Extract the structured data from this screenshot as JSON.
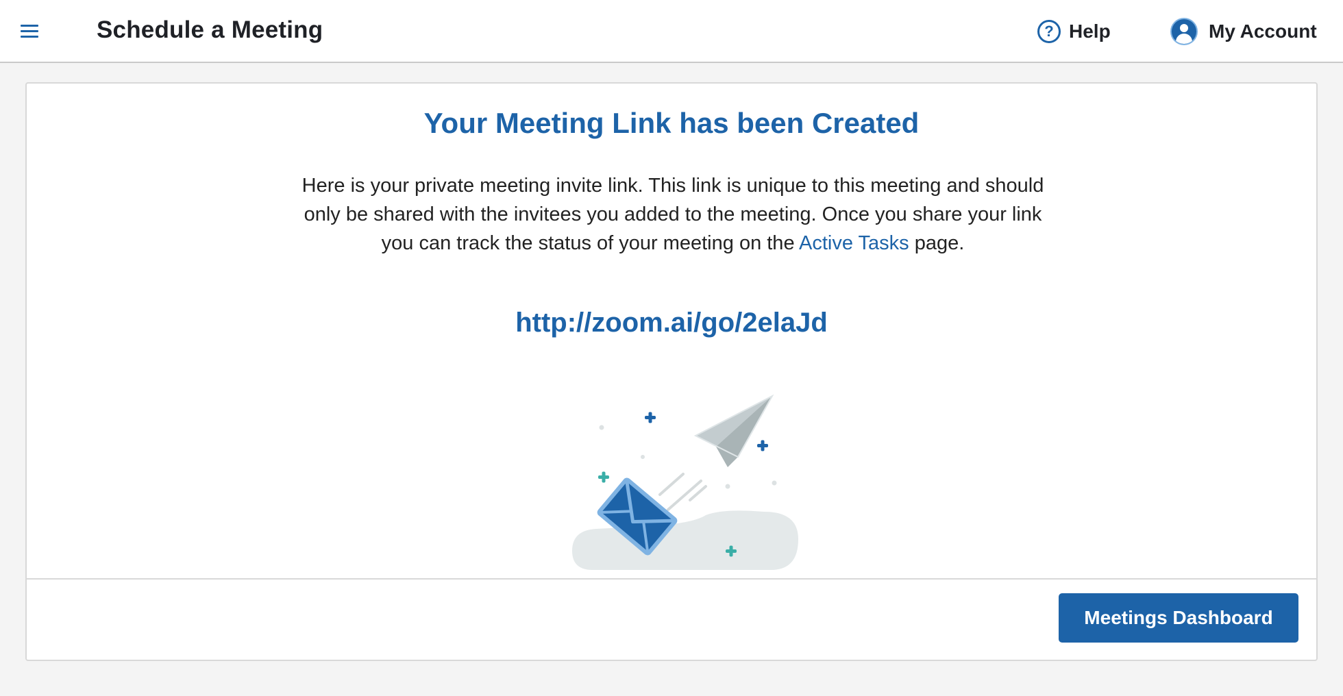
{
  "header": {
    "menu_icon": "hamburger-menu-icon",
    "title": "Schedule a Meeting",
    "help_label": "Help",
    "help_icon": "question-circle-icon",
    "account_label": "My Account",
    "account_icon": "user-avatar-icon"
  },
  "confirmation": {
    "headline": "Your Meeting Link has been Created",
    "description_before": "Here is your private meeting invite link. This link is unique to this meeting and should only be shared with the invitees you added to the meeting. Once you share your link you can track the status of your meeting on the ",
    "description_link": "Active Tasks",
    "description_after": " page.",
    "meeting_link": "http://zoom.ai/go/2elaJd",
    "illustration": "envelope-paper-plane-illustration"
  },
  "footer": {
    "dashboard_button": "Meetings Dashboard"
  },
  "colors": {
    "accent": "#1d63a8",
    "teal": "#3aaea7",
    "background": "#f4f4f4",
    "border": "#d8d8d8"
  }
}
